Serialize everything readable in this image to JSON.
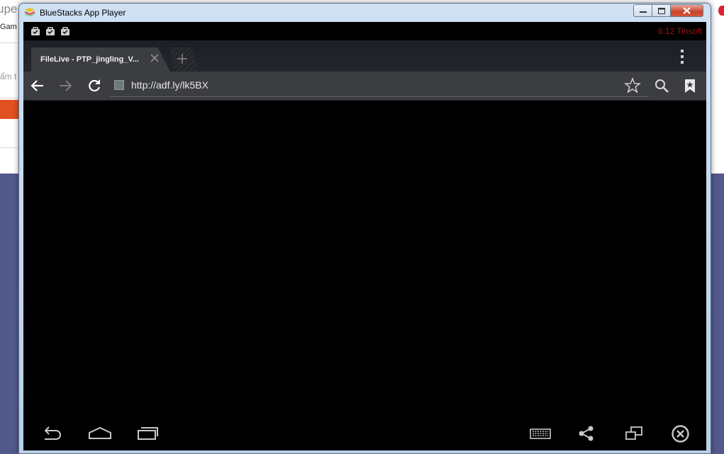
{
  "background": {
    "fragment_top": "upe",
    "fragment_game": "Gam",
    "fragment_search": "ẩm t"
  },
  "window": {
    "title": "BlueStacks App Player",
    "icon": "bluestacks-logo-icon",
    "controls": [
      "minimize-icon",
      "maximize-icon",
      "close-icon"
    ]
  },
  "statusbar": {
    "notification_icons": [
      "bag-icon",
      "bag-icon",
      "bag-icon"
    ],
    "text": "6:12 Tinsoft",
    "text_color": "#a01010"
  },
  "browser": {
    "tab_title": "FileLive - PTP_jingling_V...",
    "url": "http://adf.ly/lk5BX",
    "menu_icon": "overflow-menu-icon"
  },
  "navbar": {
    "left": [
      "back-icon",
      "home-icon",
      "recent-apps-icon"
    ],
    "right": [
      "keyboard-icon",
      "share-icon",
      "window-resize-icon",
      "exit-icon"
    ]
  },
  "colors": {
    "screen_bg": "#000000",
    "toolbar_bg": "#3b3d40",
    "tab_bg": "#3b3d40",
    "desktop_bg": "#54598c",
    "title_gradient": "#cfe0f3"
  }
}
